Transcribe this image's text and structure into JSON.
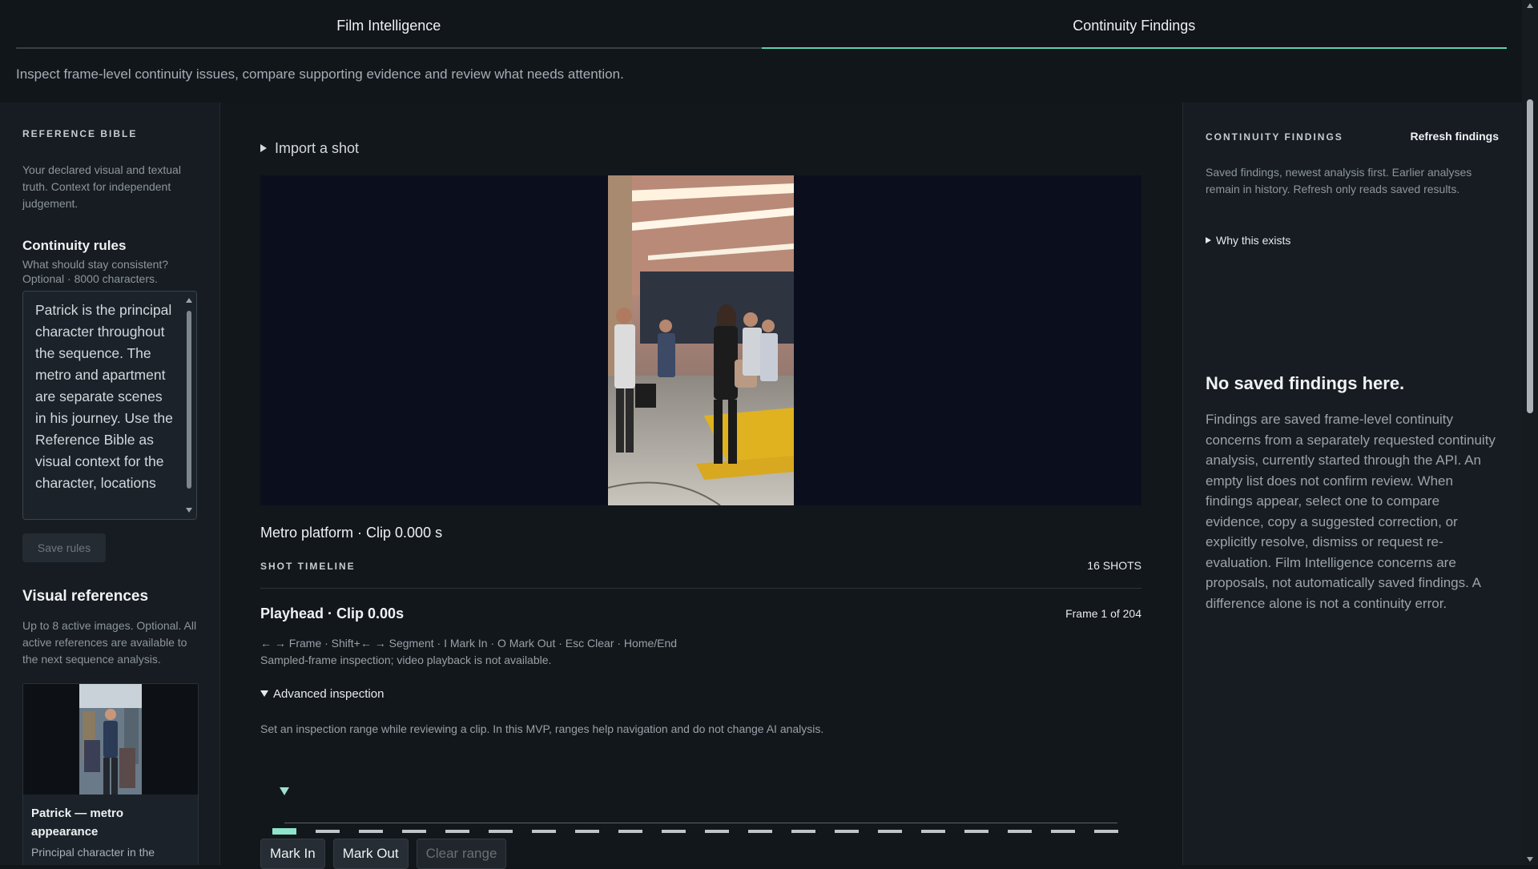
{
  "tabs": [
    {
      "label": "Film Intelligence",
      "active": false
    },
    {
      "label": "Continuity Findings",
      "active": true
    }
  ],
  "subtitle": "Inspect frame-level continuity issues, compare supporting evidence and review what needs attention.",
  "colors": {
    "accent": "#5fd0b0",
    "background": "#11161b",
    "panel": "#161c22",
    "viewer": "#0b0f1d"
  },
  "left": {
    "eyebrow": "REFERENCE BIBLE",
    "intro": "Your declared visual and textual truth. Context for independent judgement.",
    "rules_title": "Continuity rules",
    "rules_hint_1": "What should stay consistent?",
    "rules_hint_2": "Optional · 8000 characters.",
    "rules_value": "Patrick is the principal character throughout the sequence. The metro and apartment are separate scenes in his journey. Use the Reference Bible as visual context for the character, locations",
    "save_label": "Save rules",
    "visual_title": "Visual references",
    "visual_hint": "Up to 8 active images. Optional. All active references are available to the next sequence analysis.",
    "card": {
      "title": "Patrick — metro appearance",
      "desc": "Principal character in the"
    }
  },
  "center": {
    "import_label": "Import a shot",
    "caption": "Metro platform · Clip 0.000 s",
    "timeline_label": "SHOT TIMELINE",
    "shots_count": "16 SHOTS",
    "playhead": "Playhead · Clip 0.00s",
    "frame_info": "Frame 1 of 204",
    "keys": "← → Frame · Shift+← → Segment · I Mark In · O Mark Out · Esc Clear · Home/End",
    "note": "Sampled-frame inspection; video playback is not available.",
    "advanced_label": "Advanced inspection",
    "advanced_desc": "Set an inspection range while reviewing a clip. In this MVP, ranges help navigation and do not change AI analysis.",
    "segments": 20,
    "mark_in": "Mark In",
    "mark_out": "Mark Out",
    "clear_range": "Clear range"
  },
  "right": {
    "eyebrow": "CONTINUITY FINDINGS",
    "refresh_label": "Refresh findings",
    "desc": "Saved findings, newest analysis first. Earlier analyses remain in history. Refresh only reads saved results.",
    "why_label": "Why this exists",
    "empty_title": "No saved findings here.",
    "empty_desc": "Findings are saved frame-level continuity concerns from a separately requested continuity analysis, currently started through the API. An empty list does not confirm review. When findings appear, select one to compare evidence, copy a suggested correction, or explicitly resolve, dismiss or request re-evaluation. Film Intelligence concerns are proposals, not automatically saved findings. A difference alone is not a continuity error."
  }
}
